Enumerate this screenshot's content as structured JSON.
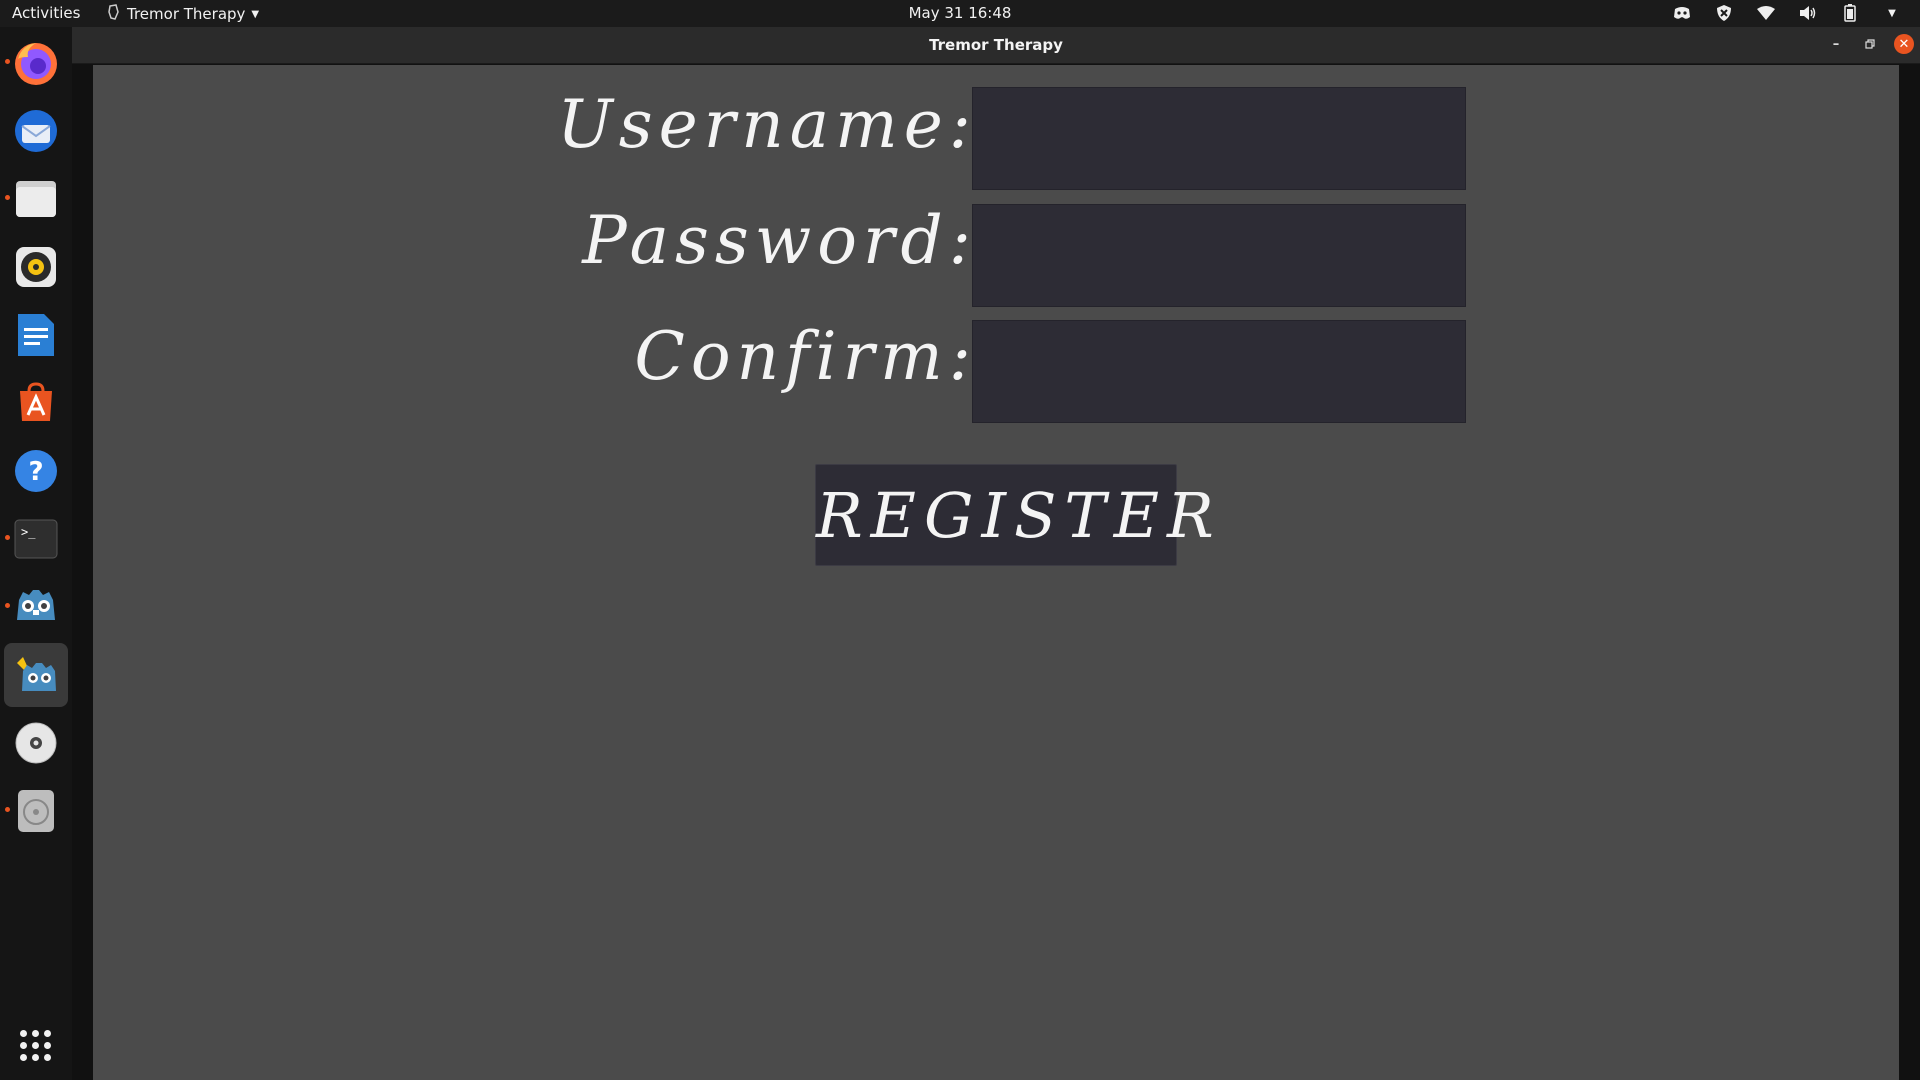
{
  "topbar": {
    "activities": "Activities",
    "app_name": "Tremor Therapy",
    "clock": "May 31  16:48",
    "tray_icons": [
      "discord-icon",
      "shield-icon",
      "wifi-icon",
      "volume-icon",
      "battery-icon",
      "system-menu-caret-icon"
    ]
  },
  "dock": {
    "items": [
      {
        "name": "firefox-icon",
        "running": true
      },
      {
        "name": "thunderbird-icon",
        "running": false
      },
      {
        "name": "files-icon",
        "running": true
      },
      {
        "name": "rhythmbox-icon",
        "running": false
      },
      {
        "name": "libreoffice-writer-icon",
        "running": false
      },
      {
        "name": "app-center-icon",
        "running": false
      },
      {
        "name": "help-icon",
        "running": false
      },
      {
        "name": "terminal-icon",
        "running": true
      },
      {
        "name": "godot-icon",
        "running": true
      },
      {
        "name": "godot-game-icon",
        "running": true,
        "active": true
      },
      {
        "name": "dvd-drive-icon",
        "running": false
      },
      {
        "name": "disk-icon",
        "running": true
      }
    ],
    "show_apps": "show-applications-icon"
  },
  "window": {
    "title": "Tremor Therapy",
    "controls": [
      "minimize-icon",
      "restore-icon",
      "close-icon"
    ]
  },
  "form": {
    "username_label": "Username:",
    "password_label": "Password:",
    "confirm_label": "Confirm:",
    "username_value": "",
    "password_value": "",
    "confirm_value": "",
    "register_label": "REGISTER"
  },
  "colors": {
    "background": "#4b4b4b",
    "input_bg": "#2d2c35",
    "accent": "#e95420"
  }
}
